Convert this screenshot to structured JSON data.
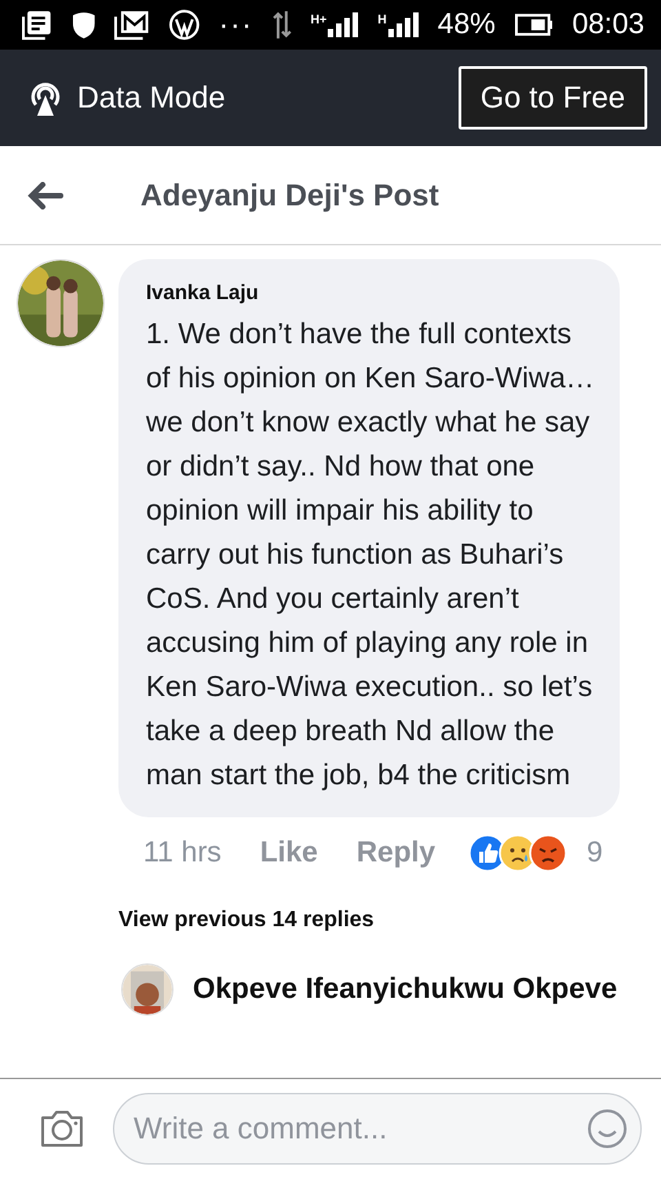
{
  "status_bar": {
    "overflow": "···",
    "network_1": "H+",
    "network_2": "H",
    "battery": "48%",
    "time": "08:03"
  },
  "data_bar": {
    "label": "Data Mode",
    "button": "Go to Free"
  },
  "header": {
    "title": "Adeyanju Deji's Post"
  },
  "comment": {
    "author": "Ivanka Laju",
    "text": "1. We don’t have the full contexts of his opinion on Ken Saro-Wiwa… we don’t know exactly what he say or didn’t say.. Nd how that one opinion will impair his ability to carry out his function as Buhari’s CoS. And you certainly aren’t accusing him of playing any role in Ken Saro-Wiwa execution.. so let’s take a deep breath Nd allow the man start the job, b4 the criticism",
    "time": "11 hrs",
    "like": "Like",
    "reply": "Reply",
    "reaction_count": "9"
  },
  "view_previous": "View previous 14 replies",
  "reply": {
    "author": "Okpeve Ifeanyichukwu Okpeve"
  },
  "composer": {
    "placeholder": "Write a comment..."
  }
}
